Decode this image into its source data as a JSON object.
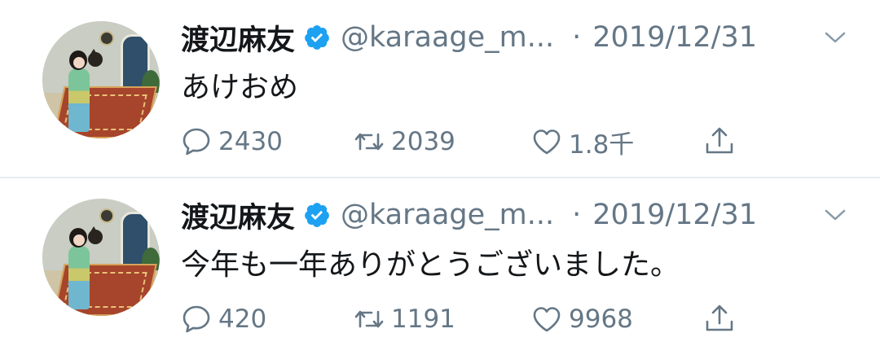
{
  "colors": {
    "text_primary": "#14171a",
    "text_secondary": "#657786",
    "verified_blue": "#1da1f2",
    "divider": "#e6ecf0"
  },
  "icons": {
    "reply": "reply-icon",
    "retweet": "retweet-icon",
    "like": "heart-icon",
    "share": "share-icon",
    "verified": "verified-badge-icon",
    "menu": "chevron-down-icon"
  },
  "tweets": [
    {
      "name": "渡辺麻友",
      "handle": "@karaage_m...",
      "separator": "·",
      "date": "2019/12/31",
      "text": "あけおめ",
      "replies": "2430",
      "retweets": "2039",
      "likes": "1.8千"
    },
    {
      "name": "渡辺麻友",
      "handle": "@karaage_m...",
      "separator": "·",
      "date": "2019/12/31",
      "text": "今年も一年ありがとうございました。",
      "replies": "420",
      "retweets": "1191",
      "likes": "9968"
    }
  ]
}
